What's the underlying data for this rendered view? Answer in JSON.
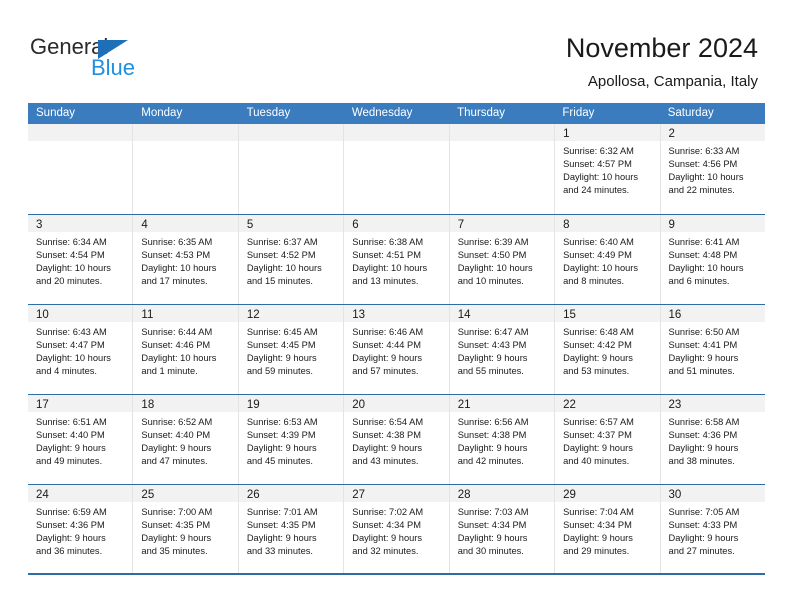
{
  "brand": {
    "name_part1": "General",
    "name_part2": "Blue",
    "triangle_icon": "triangle-icon",
    "accent_dark_blue": "#1f6fb8",
    "accent_light_blue": "#1f8fe0"
  },
  "header": {
    "title": "November 2024",
    "subtitle": "Apollosa, Campania, Italy"
  },
  "theme": {
    "header_row_blue": "#3a7cbe",
    "row_rule_blue": "#2e6da4",
    "daynum_band_gray": "#f2f2f2"
  },
  "weekdays": [
    "Sunday",
    "Monday",
    "Tuesday",
    "Wednesday",
    "Thursday",
    "Friday",
    "Saturday"
  ],
  "weeks": [
    [
      {
        "day": "",
        "sunrise": "",
        "sunset": "",
        "daylight1": "",
        "daylight2": ""
      },
      {
        "day": "",
        "sunrise": "",
        "sunset": "",
        "daylight1": "",
        "daylight2": ""
      },
      {
        "day": "",
        "sunrise": "",
        "sunset": "",
        "daylight1": "",
        "daylight2": ""
      },
      {
        "day": "",
        "sunrise": "",
        "sunset": "",
        "daylight1": "",
        "daylight2": ""
      },
      {
        "day": "",
        "sunrise": "",
        "sunset": "",
        "daylight1": "",
        "daylight2": ""
      },
      {
        "day": "1",
        "sunrise": "Sunrise: 6:32 AM",
        "sunset": "Sunset: 4:57 PM",
        "daylight1": "Daylight: 10 hours",
        "daylight2": "and 24 minutes."
      },
      {
        "day": "2",
        "sunrise": "Sunrise: 6:33 AM",
        "sunset": "Sunset: 4:56 PM",
        "daylight1": "Daylight: 10 hours",
        "daylight2": "and 22 minutes."
      }
    ],
    [
      {
        "day": "3",
        "sunrise": "Sunrise: 6:34 AM",
        "sunset": "Sunset: 4:54 PM",
        "daylight1": "Daylight: 10 hours",
        "daylight2": "and 20 minutes."
      },
      {
        "day": "4",
        "sunrise": "Sunrise: 6:35 AM",
        "sunset": "Sunset: 4:53 PM",
        "daylight1": "Daylight: 10 hours",
        "daylight2": "and 17 minutes."
      },
      {
        "day": "5",
        "sunrise": "Sunrise: 6:37 AM",
        "sunset": "Sunset: 4:52 PM",
        "daylight1": "Daylight: 10 hours",
        "daylight2": "and 15 minutes."
      },
      {
        "day": "6",
        "sunrise": "Sunrise: 6:38 AM",
        "sunset": "Sunset: 4:51 PM",
        "daylight1": "Daylight: 10 hours",
        "daylight2": "and 13 minutes."
      },
      {
        "day": "7",
        "sunrise": "Sunrise: 6:39 AM",
        "sunset": "Sunset: 4:50 PM",
        "daylight1": "Daylight: 10 hours",
        "daylight2": "and 10 minutes."
      },
      {
        "day": "8",
        "sunrise": "Sunrise: 6:40 AM",
        "sunset": "Sunset: 4:49 PM",
        "daylight1": "Daylight: 10 hours",
        "daylight2": "and 8 minutes."
      },
      {
        "day": "9",
        "sunrise": "Sunrise: 6:41 AM",
        "sunset": "Sunset: 4:48 PM",
        "daylight1": "Daylight: 10 hours",
        "daylight2": "and 6 minutes."
      }
    ],
    [
      {
        "day": "10",
        "sunrise": "Sunrise: 6:43 AM",
        "sunset": "Sunset: 4:47 PM",
        "daylight1": "Daylight: 10 hours",
        "daylight2": "and 4 minutes."
      },
      {
        "day": "11",
        "sunrise": "Sunrise: 6:44 AM",
        "sunset": "Sunset: 4:46 PM",
        "daylight1": "Daylight: 10 hours",
        "daylight2": "and 1 minute."
      },
      {
        "day": "12",
        "sunrise": "Sunrise: 6:45 AM",
        "sunset": "Sunset: 4:45 PM",
        "daylight1": "Daylight: 9 hours",
        "daylight2": "and 59 minutes."
      },
      {
        "day": "13",
        "sunrise": "Sunrise: 6:46 AM",
        "sunset": "Sunset: 4:44 PM",
        "daylight1": "Daylight: 9 hours",
        "daylight2": "and 57 minutes."
      },
      {
        "day": "14",
        "sunrise": "Sunrise: 6:47 AM",
        "sunset": "Sunset: 4:43 PM",
        "daylight1": "Daylight: 9 hours",
        "daylight2": "and 55 minutes."
      },
      {
        "day": "15",
        "sunrise": "Sunrise: 6:48 AM",
        "sunset": "Sunset: 4:42 PM",
        "daylight1": "Daylight: 9 hours",
        "daylight2": "and 53 minutes."
      },
      {
        "day": "16",
        "sunrise": "Sunrise: 6:50 AM",
        "sunset": "Sunset: 4:41 PM",
        "daylight1": "Daylight: 9 hours",
        "daylight2": "and 51 minutes."
      }
    ],
    [
      {
        "day": "17",
        "sunrise": "Sunrise: 6:51 AM",
        "sunset": "Sunset: 4:40 PM",
        "daylight1": "Daylight: 9 hours",
        "daylight2": "and 49 minutes."
      },
      {
        "day": "18",
        "sunrise": "Sunrise: 6:52 AM",
        "sunset": "Sunset: 4:40 PM",
        "daylight1": "Daylight: 9 hours",
        "daylight2": "and 47 minutes."
      },
      {
        "day": "19",
        "sunrise": "Sunrise: 6:53 AM",
        "sunset": "Sunset: 4:39 PM",
        "daylight1": "Daylight: 9 hours",
        "daylight2": "and 45 minutes."
      },
      {
        "day": "20",
        "sunrise": "Sunrise: 6:54 AM",
        "sunset": "Sunset: 4:38 PM",
        "daylight1": "Daylight: 9 hours",
        "daylight2": "and 43 minutes."
      },
      {
        "day": "21",
        "sunrise": "Sunrise: 6:56 AM",
        "sunset": "Sunset: 4:38 PM",
        "daylight1": "Daylight: 9 hours",
        "daylight2": "and 42 minutes."
      },
      {
        "day": "22",
        "sunrise": "Sunrise: 6:57 AM",
        "sunset": "Sunset: 4:37 PM",
        "daylight1": "Daylight: 9 hours",
        "daylight2": "and 40 minutes."
      },
      {
        "day": "23",
        "sunrise": "Sunrise: 6:58 AM",
        "sunset": "Sunset: 4:36 PM",
        "daylight1": "Daylight: 9 hours",
        "daylight2": "and 38 minutes."
      }
    ],
    [
      {
        "day": "24",
        "sunrise": "Sunrise: 6:59 AM",
        "sunset": "Sunset: 4:36 PM",
        "daylight1": "Daylight: 9 hours",
        "daylight2": "and 36 minutes."
      },
      {
        "day": "25",
        "sunrise": "Sunrise: 7:00 AM",
        "sunset": "Sunset: 4:35 PM",
        "daylight1": "Daylight: 9 hours",
        "daylight2": "and 35 minutes."
      },
      {
        "day": "26",
        "sunrise": "Sunrise: 7:01 AM",
        "sunset": "Sunset: 4:35 PM",
        "daylight1": "Daylight: 9 hours",
        "daylight2": "and 33 minutes."
      },
      {
        "day": "27",
        "sunrise": "Sunrise: 7:02 AM",
        "sunset": "Sunset: 4:34 PM",
        "daylight1": "Daylight: 9 hours",
        "daylight2": "and 32 minutes."
      },
      {
        "day": "28",
        "sunrise": "Sunrise: 7:03 AM",
        "sunset": "Sunset: 4:34 PM",
        "daylight1": "Daylight: 9 hours",
        "daylight2": "and 30 minutes."
      },
      {
        "day": "29",
        "sunrise": "Sunrise: 7:04 AM",
        "sunset": "Sunset: 4:34 PM",
        "daylight1": "Daylight: 9 hours",
        "daylight2": "and 29 minutes."
      },
      {
        "day": "30",
        "sunrise": "Sunrise: 7:05 AM",
        "sunset": "Sunset: 4:33 PM",
        "daylight1": "Daylight: 9 hours",
        "daylight2": "and 27 minutes."
      }
    ]
  ]
}
